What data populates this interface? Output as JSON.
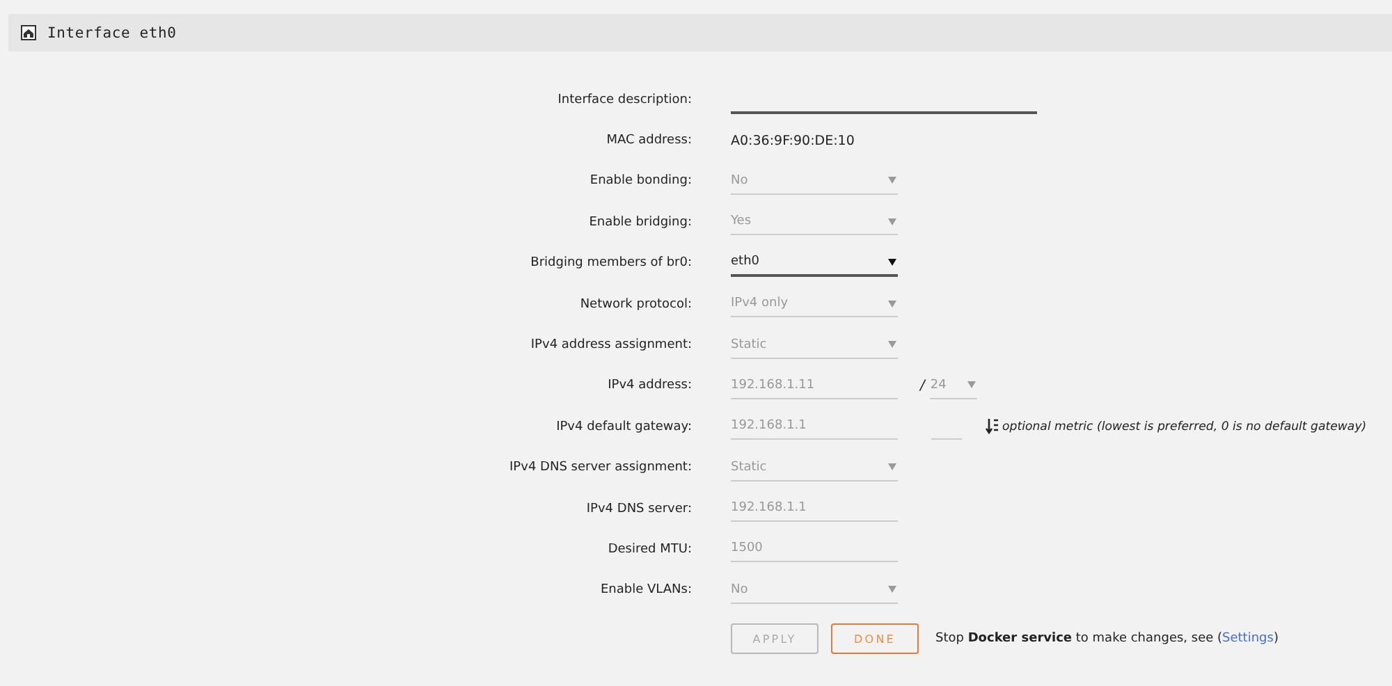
{
  "header": {
    "title": "Interface eth0"
  },
  "fields": [
    {
      "label": "Interface description:",
      "kind": "text",
      "disabled": false
    },
    {
      "label": "MAC address:",
      "kind": "static",
      "value": "A0:36:9F:90:DE:10"
    },
    {
      "label": "Enable bonding:",
      "kind": "select",
      "value": "No",
      "disabled": true
    },
    {
      "label": "Enable bridging:",
      "kind": "select",
      "value": "Yes",
      "disabled": true
    },
    {
      "label": "Bridging members of br0:",
      "kind": "select",
      "value": "eth0",
      "disabled": false
    },
    {
      "label": "Network protocol:",
      "kind": "select",
      "value": "IPv4 only",
      "disabled": true
    },
    {
      "label": "IPv4 address assignment:",
      "kind": "select",
      "value": "Static",
      "disabled": true
    },
    {
      "label": "IPv4 address:",
      "kind": "text",
      "value": "192.168.1.11",
      "disabled": true,
      "prefix": {
        "separator": "/",
        "value": "24",
        "disabled": true
      }
    },
    {
      "label": "IPv4 default gateway:",
      "kind": "text",
      "value": "192.168.1.1",
      "disabled": true,
      "metric": {
        "disabled": true,
        "note": "optional metric (lowest is preferred, 0 is no default gateway)"
      }
    },
    {
      "label": "IPv4 DNS server assignment:",
      "kind": "select",
      "value": "Static",
      "disabled": true
    },
    {
      "label": "IPv4 DNS server:",
      "kind": "text",
      "value": "192.168.1.1",
      "disabled": true
    },
    {
      "label": "Desired MTU:",
      "kind": "text",
      "value": "1500",
      "disabled": true
    },
    {
      "label": "Enable VLANs:",
      "kind": "select",
      "value": "No",
      "disabled": true
    }
  ],
  "buttons": [
    {
      "label": "APPLY",
      "kind": "apply",
      "disabled": true
    },
    {
      "label": "DONE",
      "kind": "done",
      "disabled": false
    }
  ],
  "message": {
    "before": "Stop **Docker service** to make changes, see (",
    "link": "Settings",
    "after": ")"
  }
}
